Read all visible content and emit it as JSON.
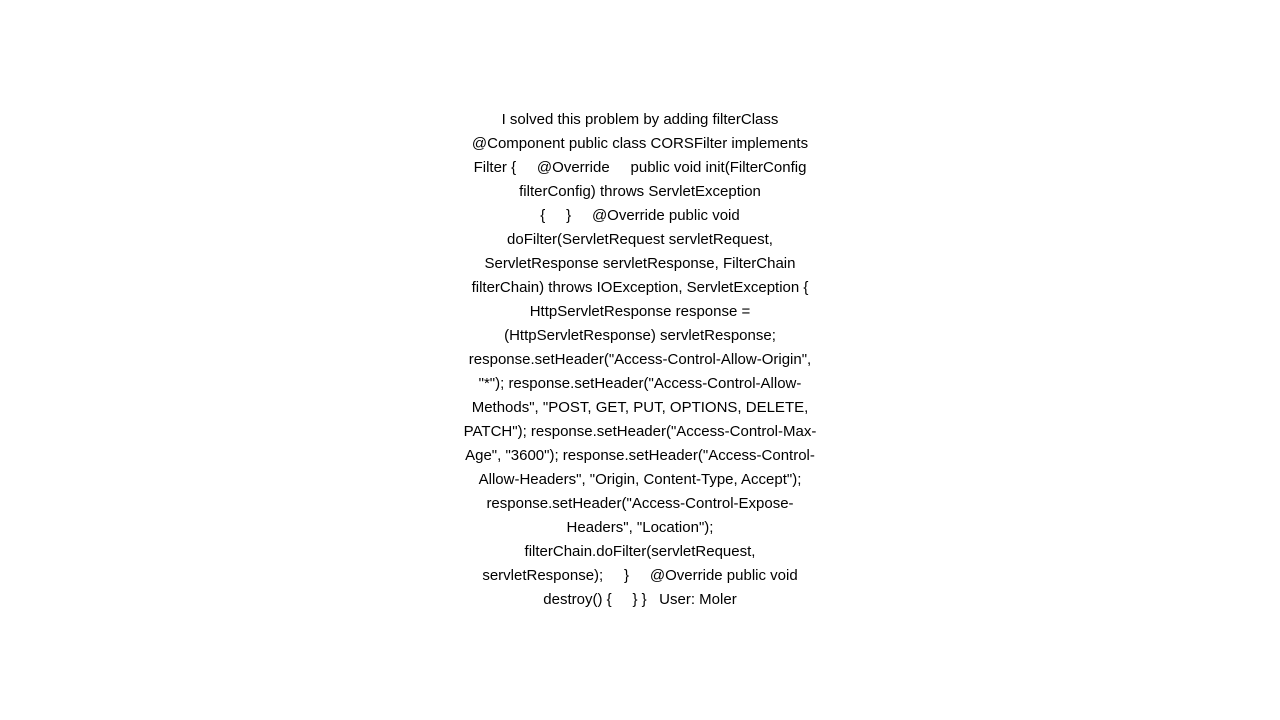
{
  "main": {
    "text": "I solved this problem by adding filterClass @Component public class CORSFilter implements Filter {     @Override     public void init(FilterConfig filterConfig) throws ServletException {     }     @Override public void doFilter(ServletRequest servletRequest, ServletResponse servletResponse, FilterChain filterChain) throws IOException, ServletException { HttpServletResponse response = (HttpServletResponse) servletResponse; response.setHeader(\"Access-Control-Allow-Origin\", \"*\"); response.setHeader(\"Access-Control-Allow-Methods\", \"POST, GET, PUT, OPTIONS, DELETE, PATCH\"); response.setHeader(\"Access-Control-Max-Age\", \"3600\"); response.setHeader(\"Access-Control-Allow-Headers\", \"Origin, Content-Type, Accept\"); response.setHeader(\"Access-Control-Expose-Headers\", \"Location\"); filterChain.doFilter(servletRequest, servletResponse);     }     @Override public void destroy() {     } }   User: Moler"
  }
}
